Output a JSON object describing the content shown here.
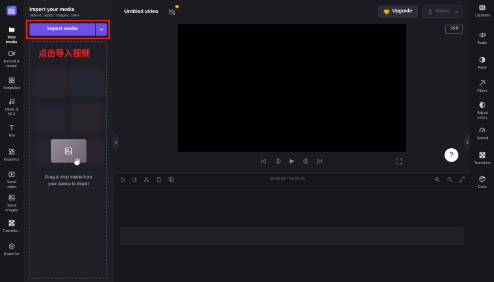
{
  "colors": {
    "accent": "#6b4fe6",
    "annotation": "#e8242c",
    "premium": "#f4c025"
  },
  "left_nav": {
    "logo_icon": "clipchamp-logo-icon",
    "items": [
      {
        "label": "Your media",
        "icon": "folder-icon",
        "active": true
      },
      {
        "label": "Record & create",
        "icon": "camera-icon"
      },
      {
        "label": "Templates",
        "icon": "templates-icon"
      },
      {
        "label": "Music & SFX",
        "icon": "music-note-icon"
      },
      {
        "label": "Text",
        "icon": "text-icon"
      },
      {
        "label": "Graphics",
        "icon": "shapes-icon"
      },
      {
        "label": "Stock video",
        "icon": "stock-video-icon"
      },
      {
        "label": "Stock images",
        "icon": "stock-images-icon"
      },
      {
        "label": "Transitio...",
        "icon": "transition-icon"
      },
      {
        "label": "Brand kit",
        "icon": "brand-kit-icon"
      }
    ]
  },
  "media_panel": {
    "title": "Import your media",
    "subtitle": "Videos, audio, images, GIFs",
    "import_button": "Import media",
    "dropdown_icon": "chevron-down-icon",
    "annotation": "点击导入视频",
    "drop_icon": "image-placeholder-icon",
    "cursor_icon": "hand-cursor-icon",
    "drop_hint": "Drag & drop media from your device to import"
  },
  "header": {
    "project_title": "Untitled video",
    "sync_icon": "cloud-off-icon",
    "upgrade_label": "Upgrade",
    "upgrade_icon": "premium-diamond-icon",
    "export_label": "Export",
    "export_icon": "upload-icon",
    "export_enabled": false
  },
  "preview": {
    "aspect_ratio": "16:9",
    "help_label": "?"
  },
  "playback": {
    "controls": [
      "skip-back-icon",
      "rewind-5-icon",
      "play-icon",
      "forward-5-icon",
      "skip-forward-icon"
    ],
    "fullscreen_icon": "fullscreen-icon"
  },
  "timeline": {
    "time": "00:00.00 / 00:00.00",
    "tools": [
      "undo-icon",
      "redo-icon",
      "cut-icon",
      "delete-icon",
      "duplicate-icon"
    ],
    "zoom": [
      "zoom-in-icon",
      "zoom-out-icon",
      "zoom-fit-icon"
    ]
  },
  "right_nav": {
    "items": [
      {
        "label": "Captions",
        "icon": "captions-icon"
      },
      {
        "label": "Audio",
        "icon": "audio-icon"
      },
      {
        "label": "Fade",
        "icon": "fade-icon"
      },
      {
        "label": "Filters",
        "icon": "filters-icon"
      },
      {
        "label": "Adjust colors",
        "icon": "adjust-colors-icon"
      },
      {
        "label": "Speed",
        "icon": "speed-icon"
      },
      {
        "label": "Transition",
        "icon": "transition-icon"
      },
      {
        "label": "Color",
        "icon": "color-icon"
      }
    ]
  }
}
